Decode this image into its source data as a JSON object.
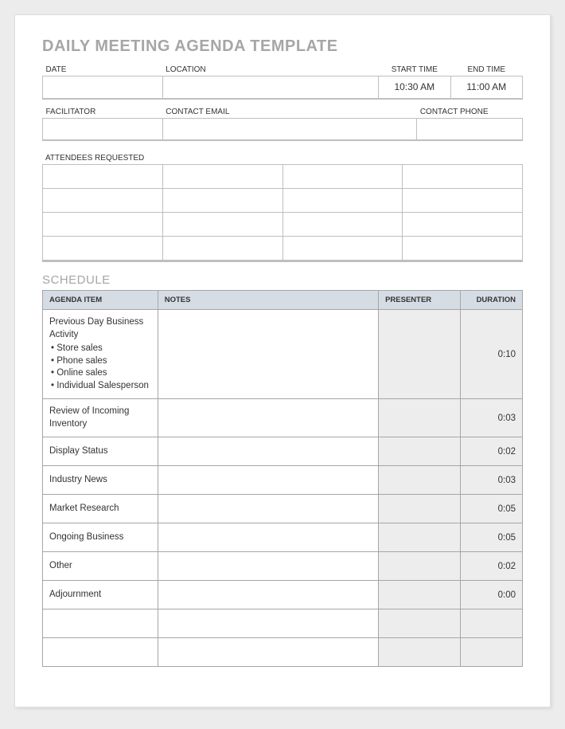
{
  "title": "DAILY MEETING AGENDA TEMPLATE",
  "info1": {
    "labels": {
      "date": "DATE",
      "location": "LOCATION",
      "start": "START TIME",
      "end": "END TIME"
    },
    "values": {
      "date": "",
      "location": "",
      "start": "10:30 AM",
      "end": "11:00 AM"
    }
  },
  "info2": {
    "labels": {
      "facilitator": "FACILITATOR",
      "email": "CONTACT EMAIL",
      "phone": "CONTACT PHONE"
    },
    "values": {
      "facilitator": "",
      "email": "",
      "phone": ""
    }
  },
  "attendees_label": "ATTENDEES REQUESTED",
  "schedule_title": "SCHEDULE",
  "schedule": {
    "headers": {
      "item": "AGENDA ITEM",
      "notes": "NOTES",
      "presenter": "PRESENTER",
      "duration": "DURATION"
    },
    "rows": [
      {
        "item": "Previous Day Business Activity",
        "bullets": [
          "Store sales",
          "Phone sales",
          "Online sales",
          "Individual Salesperson"
        ],
        "notes": "",
        "presenter": "",
        "duration": "0:10"
      },
      {
        "item": "Review of Incoming Inventory",
        "notes": "",
        "presenter": "",
        "duration": "0:03"
      },
      {
        "item": "Display Status",
        "notes": "",
        "presenter": "",
        "duration": "0:02"
      },
      {
        "item": "Industry News",
        "notes": "",
        "presenter": "",
        "duration": "0:03"
      },
      {
        "item": "Market Research",
        "notes": "",
        "presenter": "",
        "duration": "0:05"
      },
      {
        "item": "Ongoing Business",
        "notes": "",
        "presenter": "",
        "duration": "0:05"
      },
      {
        "item": "Other",
        "notes": "",
        "presenter": "",
        "duration": "0:02"
      },
      {
        "item": "Adjournment",
        "notes": "",
        "presenter": "",
        "duration": "0:00"
      },
      {
        "item": "",
        "notes": "",
        "presenter": "",
        "duration": ""
      },
      {
        "item": "",
        "notes": "",
        "presenter": "",
        "duration": ""
      }
    ]
  }
}
